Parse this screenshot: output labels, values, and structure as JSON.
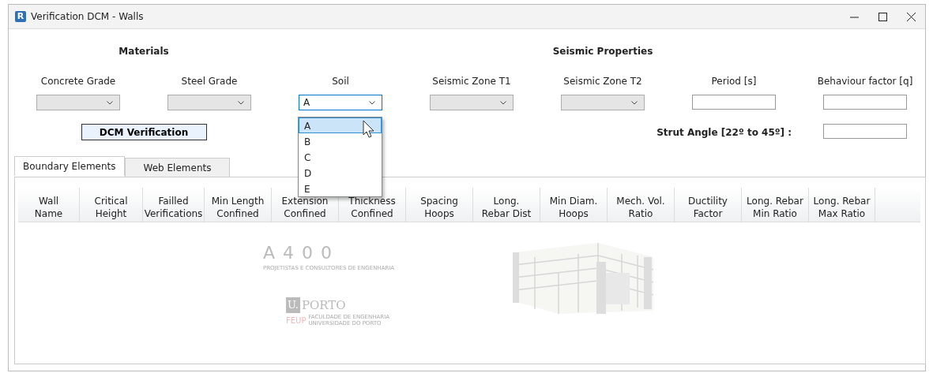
{
  "window": {
    "icon_letter": "R",
    "title": "Verification DCM - Walls"
  },
  "sections": [
    {
      "title": "Materials",
      "kind": "left"
    },
    {
      "title": "Seismic Properties",
      "kind": "right"
    }
  ],
  "fields": [
    {
      "label": "Concrete Grade",
      "kind": "combo",
      "disabled": true
    },
    {
      "label": "Steel Grade",
      "kind": "combo",
      "disabled": true
    },
    {
      "label": "Soil",
      "kind": "combo",
      "disabled": false,
      "value": "A",
      "expanded": true
    },
    {
      "label": "Seismic Zone T1",
      "kind": "combo",
      "disabled": true
    },
    {
      "label": "Seismic Zone T2",
      "kind": "combo",
      "disabled": true
    },
    {
      "label": "Period [s]",
      "kind": "text"
    },
    {
      "label": "Behaviour factor [q]",
      "kind": "text"
    }
  ],
  "verify_button": "DCM Verification",
  "strut_angle": {
    "label": "Strut Angle [22º to 45º] :"
  },
  "soil_options": [
    {
      "label": "A",
      "selected": true
    },
    {
      "label": "B",
      "selected": false
    },
    {
      "label": "C",
      "selected": false
    },
    {
      "label": "D",
      "selected": false
    },
    {
      "label": "E",
      "selected": false
    }
  ],
  "tabs": [
    {
      "label": "Boundary Elements",
      "selected": true
    },
    {
      "label": "Web Elements",
      "selected": false
    }
  ],
  "table": {
    "columns": [
      [
        "Wall",
        "Name"
      ],
      [
        "Critical",
        "Height"
      ],
      [
        "Failled",
        "Verifications"
      ],
      [
        "Min Length",
        "Confined"
      ],
      [
        "Extension",
        "Confined"
      ],
      [
        "Thickness",
        "Confined"
      ],
      [
        "Spacing",
        "Hoops"
      ],
      [
        "Long.",
        "Rebar Dist"
      ],
      [
        "Min Diam.",
        "Hoops"
      ],
      [
        "Mech. Vol.",
        "Ratio"
      ],
      [
        "Ductility",
        "Factor"
      ],
      [
        "Long. Rebar",
        "Min Ratio"
      ],
      [
        "Long. Rebar",
        "Max Ratio"
      ]
    ]
  },
  "logos": {
    "a400": "A400",
    "a400_tagline": "PROJETISTAS E CONSULTORES DE ENGENHARIA",
    "uporto_mark": "U.",
    "uporto_name": "PORTO",
    "feup": "FEUP",
    "feup_line1": "FACULDADE DE ENGENHARIA",
    "feup_line2": "UNIVERSIDADE DO PORTO"
  }
}
